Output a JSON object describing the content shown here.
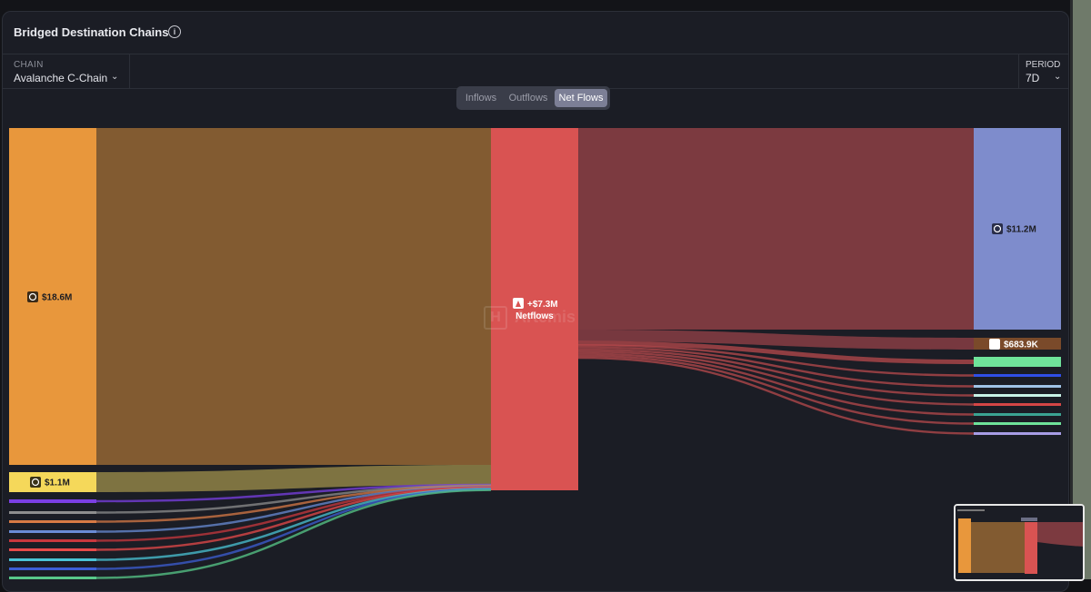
{
  "card": {
    "title": "Bridged Destination Chains",
    "info_icon": "i"
  },
  "filters": {
    "chain": {
      "label": "CHAIN",
      "value": "Avalanche C-Chain"
    },
    "period": {
      "label": "PERIOD",
      "value": "7D"
    }
  },
  "toggle": {
    "options": [
      "Inflows",
      "Outflows",
      "Net Flows"
    ],
    "selected": "Net Flows"
  },
  "watermark": {
    "text": "Artemis"
  },
  "chart_data": {
    "type": "sankey",
    "center": {
      "label": "+$7.3M",
      "sublabel": "Netflows",
      "color": "#d95352"
    },
    "sources": [
      {
        "label": "$18.6M",
        "color": "#e8973c",
        "icon": "bitcoin-coin-icon"
      },
      {
        "label": "$1.1M",
        "color": "#f5d85a",
        "icon": "bnb-coin-icon"
      },
      {
        "label": "",
        "color": "#7b3fe4"
      },
      {
        "label": "",
        "color": "#8e8e8e"
      },
      {
        "label": "",
        "color": "#d87a45"
      },
      {
        "label": "",
        "color": "#6a8cd6"
      },
      {
        "label": "",
        "color": "#c9383e"
      },
      {
        "label": "",
        "color": "#e84a4a"
      },
      {
        "label": "",
        "color": "#4bc4d6"
      },
      {
        "label": "",
        "color": "#3d5fd6"
      },
      {
        "label": "",
        "color": "#58c98a"
      }
    ],
    "targets": [
      {
        "label": "$11.2M",
        "color": "#7e8ccc",
        "icon": "ethereum-coin-icon"
      },
      {
        "label": "$683.9K",
        "color": "#7a4a2a",
        "icon": "chain-token-icon"
      },
      {
        "label": "",
        "color": "#6fe39a"
      },
      {
        "label": "",
        "color": "#2f4fe6"
      },
      {
        "label": "",
        "color": "#9fc2e6"
      },
      {
        "label": "",
        "color": "#c7f2e6"
      },
      {
        "label": "",
        "color": "#d44646"
      },
      {
        "label": "",
        "color": "#3ba392"
      },
      {
        "label": "",
        "color": "#6fe39a"
      },
      {
        "label": "",
        "color": "#a79de6"
      }
    ],
    "bands_in": [
      {
        "from": 0,
        "color": "#825b31"
      },
      {
        "from": 1,
        "color": "#8a7d45"
      }
    ],
    "bands_out_color": "#7c3a40"
  }
}
